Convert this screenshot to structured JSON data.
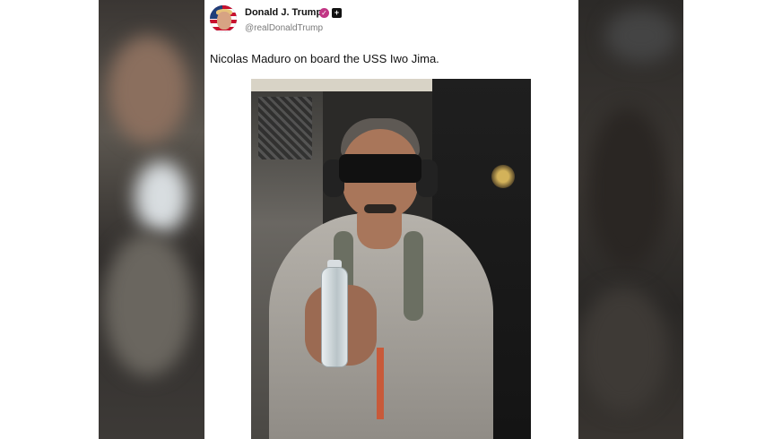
{
  "post": {
    "author_name": "Donald J. Trump",
    "author_handle": "@realDonaldTrump",
    "verified_icon": "verified-badge-icon",
    "extra_badge": "+",
    "text": "Nicolas Maduro on board the USS Iwo Jima."
  },
  "colors": {
    "background": "#ffffff",
    "name_text": "#111111",
    "handle_text": "#7a7a7a",
    "verified_badge": "#c13584"
  }
}
